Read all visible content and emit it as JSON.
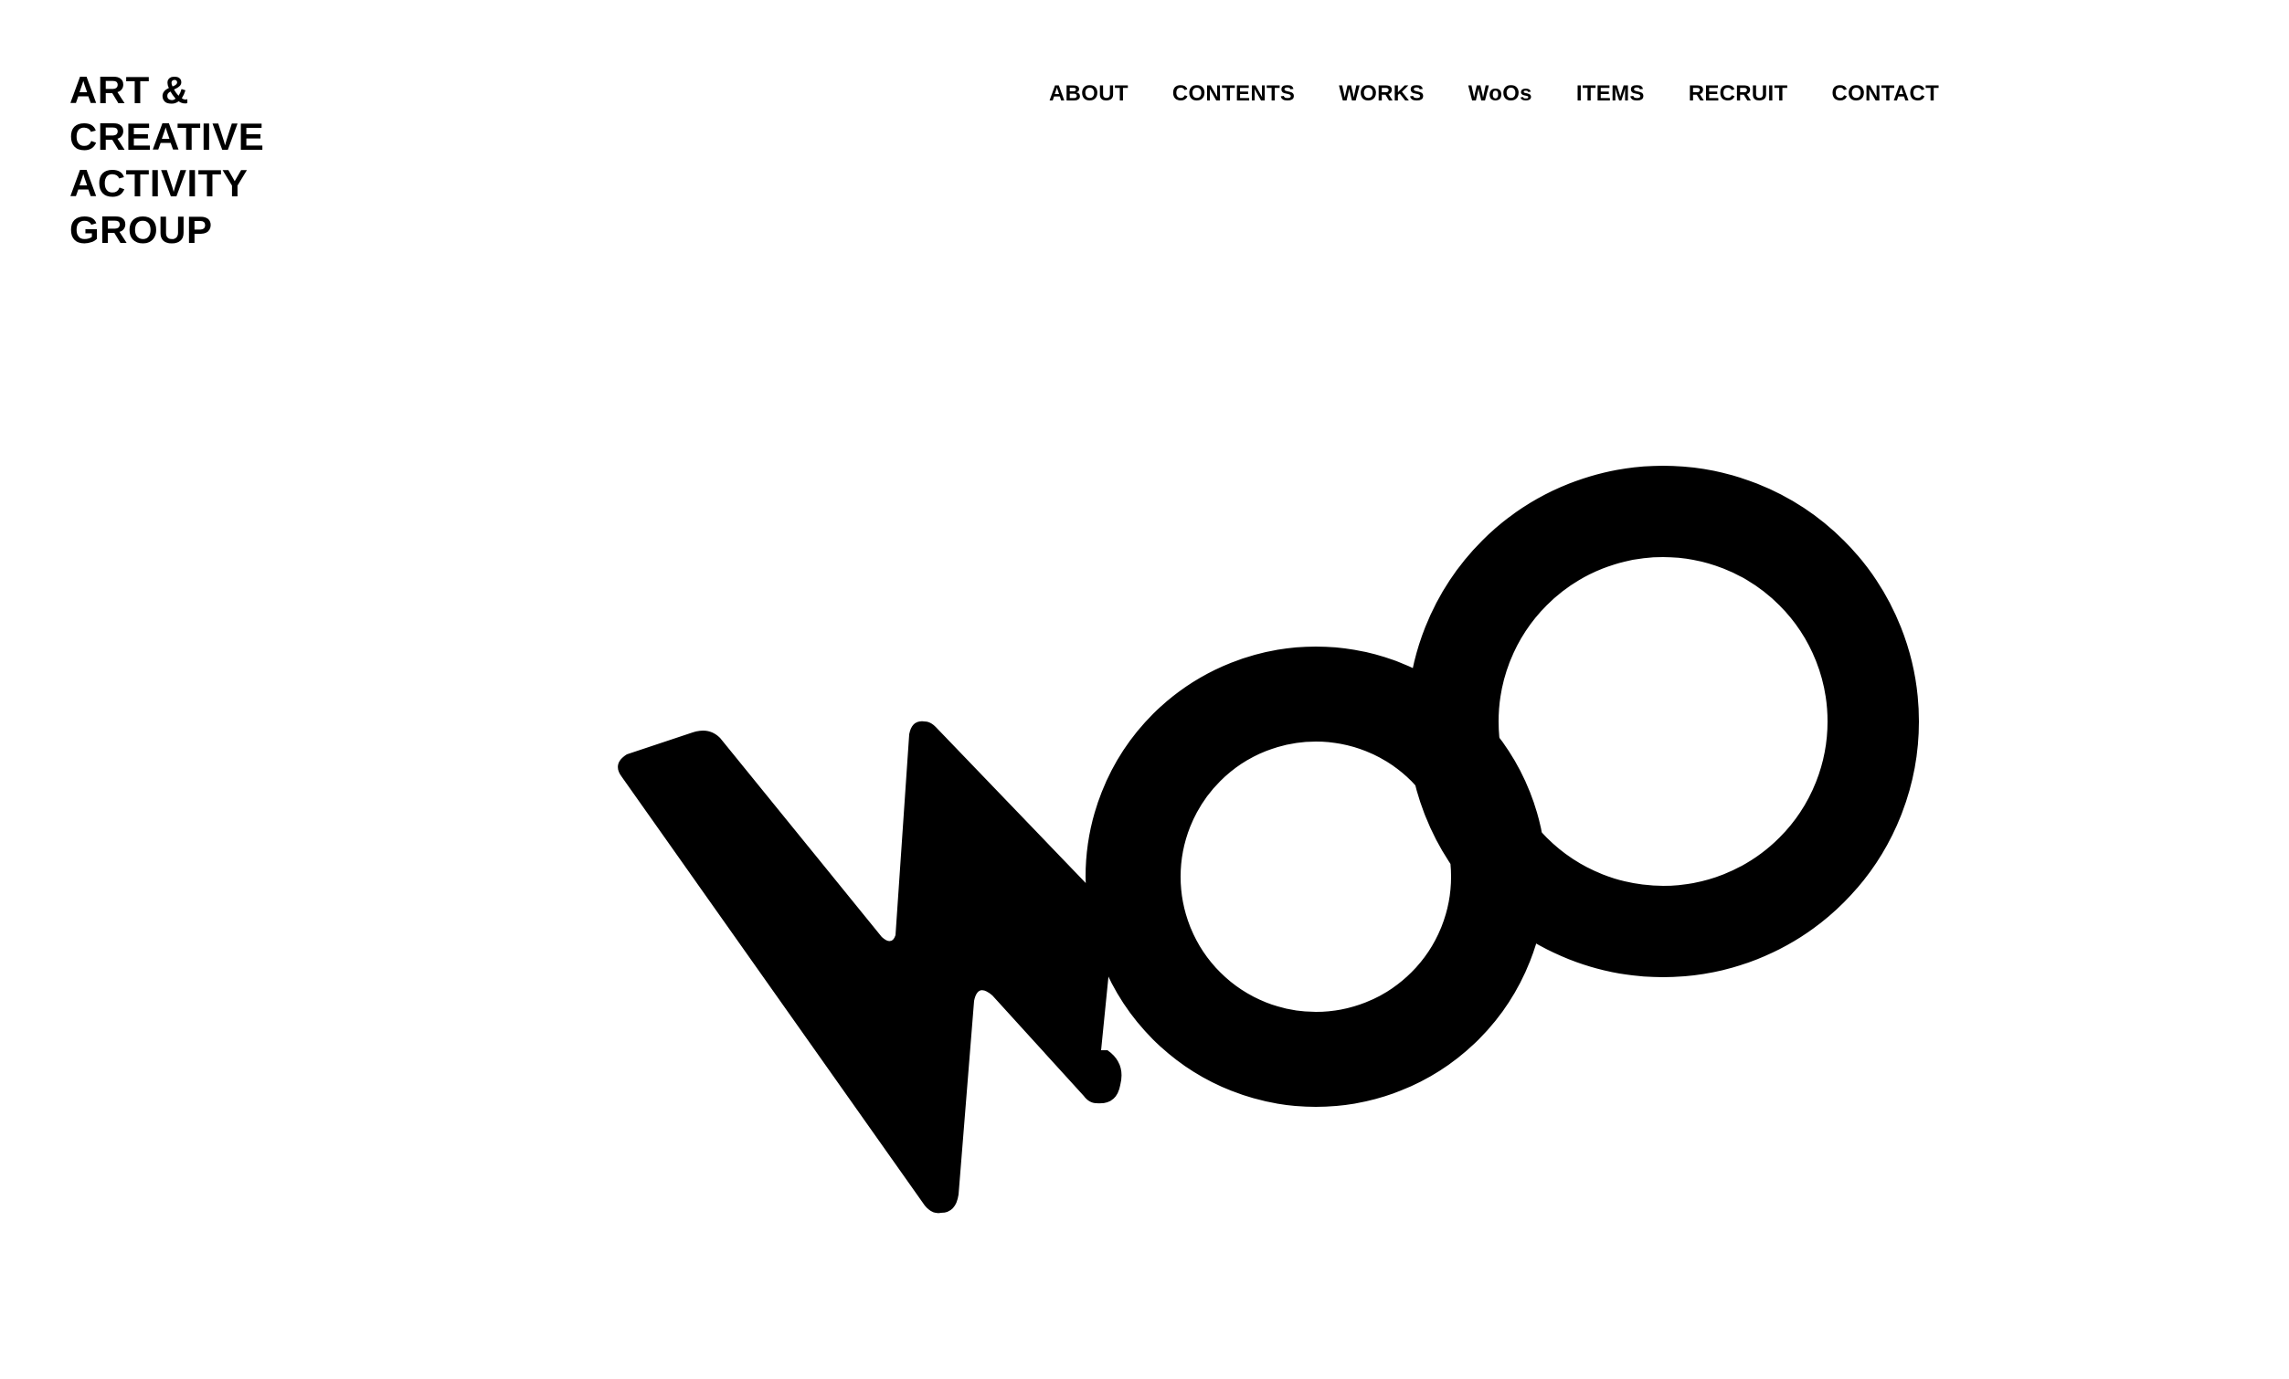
{
  "header": {
    "brand_lines": [
      "ART &",
      "CREATIVE",
      "ACTIVITY",
      "GROUP"
    ]
  },
  "nav": {
    "items": [
      {
        "label": "ABOUT"
      },
      {
        "label": "CONTENTS"
      },
      {
        "label": "WORKS"
      },
      {
        "label": "WoOs"
      },
      {
        "label": "ITEMS"
      },
      {
        "label": "RECRUIT"
      },
      {
        "label": "CONTACT"
      }
    ]
  },
  "hero": {
    "logo_text": "WoO",
    "logo_icon": "woo-logo",
    "colors": {
      "ink": "#000000",
      "background": "#ffffff"
    }
  }
}
